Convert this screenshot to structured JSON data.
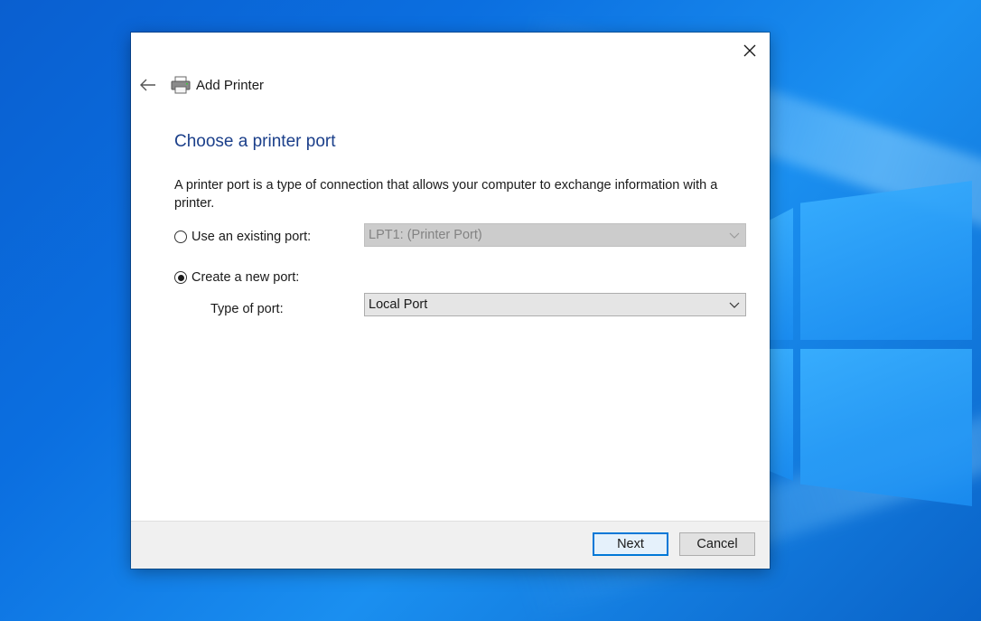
{
  "window": {
    "title": "Add Printer",
    "close_icon": "close-icon",
    "back_icon": "back-arrow-icon",
    "app_icon": "printer-icon"
  },
  "page": {
    "heading": "Choose a printer port",
    "description": "A printer port is a type of connection that allows your computer to exchange information with a printer."
  },
  "options": {
    "existing_port": {
      "label": "Use an existing port:",
      "selected": false,
      "value": "LPT1: (Printer Port)",
      "enabled": false
    },
    "new_port": {
      "label": "Create a new port:",
      "selected": true
    },
    "type_of_port": {
      "label": "Type of port:",
      "value": "Local Port",
      "enabled": true
    }
  },
  "footer": {
    "next_label": "Next",
    "cancel_label": "Cancel"
  },
  "colors": {
    "heading": "#1b3f8a",
    "default_button_border": "#0078d7",
    "desktop": "#0b6fe0"
  }
}
